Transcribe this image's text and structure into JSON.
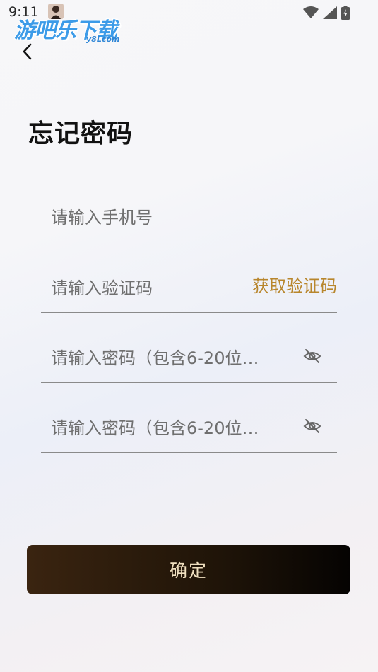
{
  "status_bar": {
    "time": "9:11"
  },
  "watermark": {
    "title": "游吧乐下载",
    "subtitle": "y8Lcom"
  },
  "page": {
    "title": "忘记密码"
  },
  "form": {
    "phone_placeholder": "请输入手机号",
    "code_placeholder": "请输入验证码",
    "get_code_label": "获取验证码",
    "password_placeholder": "请输入密码（包含6-20位…",
    "confirm_password_placeholder": "请输入密码（包含6-20位…",
    "submit_label": "确定"
  },
  "colors": {
    "accent_gold": "#b8862c",
    "button_dark_start": "#3a2410",
    "button_dark_end": "#050302",
    "watermark_blue": "#3c9be8"
  },
  "icons": {
    "back": "chevron-left-icon",
    "eye_hidden": "eye-off-icon",
    "wifi": "wifi-icon",
    "signal": "signal-icon",
    "battery": "battery-icon"
  }
}
